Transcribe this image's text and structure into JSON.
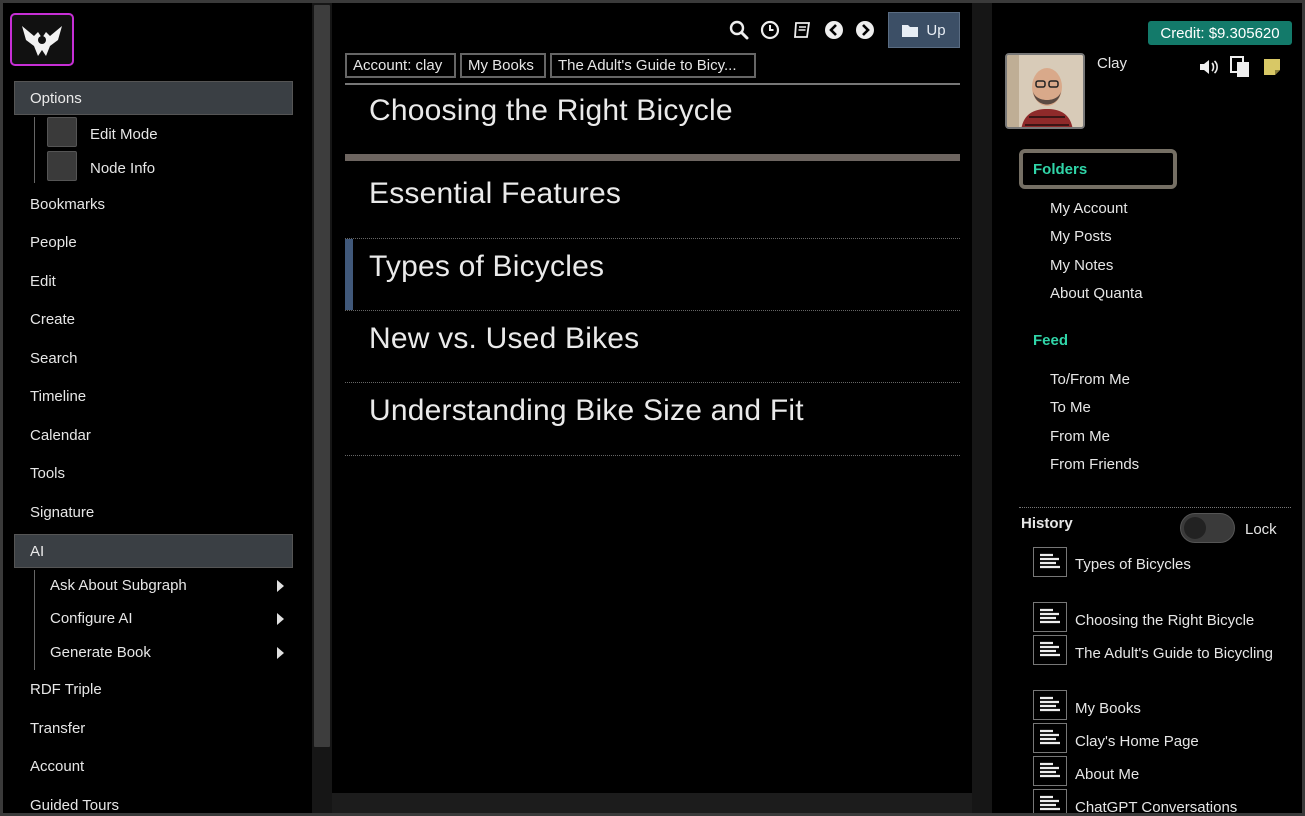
{
  "left_menu": {
    "options_label": "Options",
    "options_sub": [
      "Edit Mode",
      "Node Info"
    ],
    "items_a": [
      "Bookmarks",
      "People",
      "Edit",
      "Create",
      "Search",
      "Timeline",
      "Calendar",
      "Tools",
      "Signature"
    ],
    "ai_label": "AI",
    "ai_sub": [
      "Ask About Subgraph",
      "Configure AI",
      "Generate Book"
    ],
    "items_b": [
      "RDF Triple",
      "Transfer",
      "Account",
      "Guided Tours"
    ]
  },
  "toolbar": {
    "icons": [
      "search-icon",
      "clock-icon",
      "book-icon",
      "back-arrow-icon",
      "forward-arrow-icon"
    ],
    "up_label": "Up"
  },
  "breadcrumbs": [
    "Account: clay",
    "My Books",
    "The Adult's Guide to Bicy..."
  ],
  "content": {
    "parent_title": "Choosing the Right Bicycle",
    "children": [
      "Essential Features",
      "Types of Bicycles",
      "New vs. Used Bikes",
      "Understanding Bike Size and Fit"
    ]
  },
  "right": {
    "credit": "Credit: $9.305620",
    "user_name": "Clay",
    "folders_title": "Folders",
    "folders": [
      "My Account",
      "My Posts",
      "My Notes",
      "About Quanta"
    ],
    "feed_title": "Feed",
    "feed": [
      "To/From Me",
      "To Me",
      "From Me",
      "From Friends"
    ],
    "history_title": "History",
    "lock_label": "Lock",
    "history": [
      "Types of Bicycles",
      "Choosing the Right Bicycle",
      "The Adult's Guide to Bicycling",
      "My Books",
      "Clay's Home Page",
      "About Me",
      "ChatGPT Conversations"
    ]
  },
  "colors": {
    "accent_green": "#30d5a8",
    "credit_bg": "#137a6a",
    "logo_border": "#c72fd6",
    "up_button": "#3c4f66",
    "selected_bar": "#40587a"
  }
}
